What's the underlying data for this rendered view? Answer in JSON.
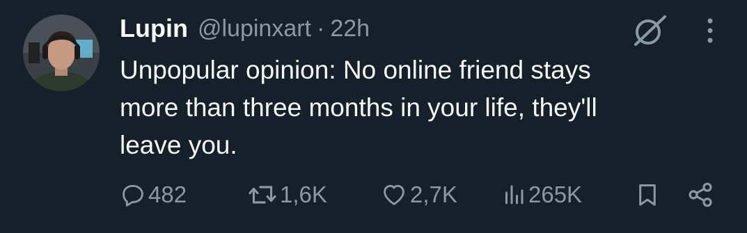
{
  "post": {
    "author_name": "Lupin",
    "author_handle": "@lupinxart",
    "separator": "·",
    "time": "22h",
    "text_lines": [
      "Unpopular opinion: No online friend stays",
      "more than three months in your life, they'll",
      "leave you."
    ]
  },
  "actions": {
    "replies": "482",
    "reposts": "1,6K",
    "likes": "2,7K",
    "views": "265K"
  },
  "icons": {
    "grok": "grok-icon",
    "more": "more-icon",
    "reply": "reply-icon",
    "repost": "repost-icon",
    "like": "heart-icon",
    "views": "views-icon",
    "bookmark": "bookmark-icon",
    "share": "share-icon"
  },
  "colors": {
    "background": "#15202b",
    "primary_text": "#f7f9f9",
    "secondary_text": "#8b98a5"
  }
}
